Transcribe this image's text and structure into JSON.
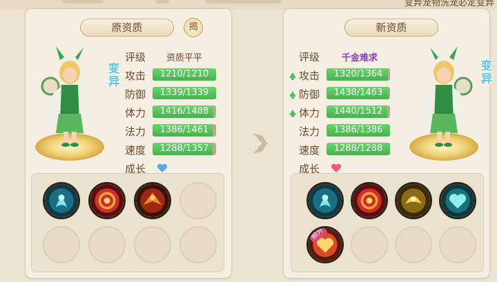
{
  "header": {
    "notice_text": "变异宠物洗宠必定变异"
  },
  "left_panel": {
    "title": "原资质",
    "reveal_label": "揭",
    "mutant_tag": "变异",
    "grade_label": "评级",
    "grade_value": "资质平平",
    "growth_label": "成长",
    "growth_icon": "blue-heart-icon",
    "stats": [
      {
        "label": "攻击",
        "value": "1210/1210",
        "fill": 1.0
      },
      {
        "label": "防御",
        "value": "1339/1339",
        "fill": 1.0
      },
      {
        "label": "体力",
        "value": "1416/1488",
        "fill": 0.952
      },
      {
        "label": "法力",
        "value": "1386/1461",
        "fill": 0.949
      },
      {
        "label": "速度",
        "value": "1288/1357",
        "fill": 0.949
      }
    ],
    "skills": [
      "water-spirit-skill-icon",
      "fire-vortex-skill-icon",
      "phoenix-fire-skill-icon",
      "empty",
      "empty",
      "empty",
      "empty",
      "empty"
    ]
  },
  "right_panel": {
    "title": "新资质",
    "mutant_tag": "变异",
    "grade_label": "评级",
    "grade_value": "千金难求",
    "growth_label": "成长",
    "growth_icon": "pink-heart-icon",
    "stats": [
      {
        "label": "攻击",
        "value": "1320/1364",
        "fill": 0.968,
        "up": true
      },
      {
        "label": "防御",
        "value": "1438/1463",
        "fill": 0.983,
        "up": true
      },
      {
        "label": "体力",
        "value": "1440/1512",
        "fill": 0.952,
        "up": true
      },
      {
        "label": "法力",
        "value": "1386/1386",
        "fill": 1.0,
        "up": false
      },
      {
        "label": "速度",
        "value": "1288/1288",
        "fill": 1.0,
        "up": false
      }
    ],
    "skills": [
      "water-spirit-skill-icon",
      "fire-vortex-skill-icon",
      "golden-phoenix-skill-icon",
      "teal-heart-skill-icon",
      "extra-heart-skill-icon",
      "empty",
      "empty",
      "empty"
    ],
    "extra_badge": "额外"
  },
  "colors": {
    "bar_green": "#45b34c",
    "bar_track": "#bca78f",
    "grade_rare": "#8a3db8",
    "mutant_blue": "#5fc6e8"
  }
}
